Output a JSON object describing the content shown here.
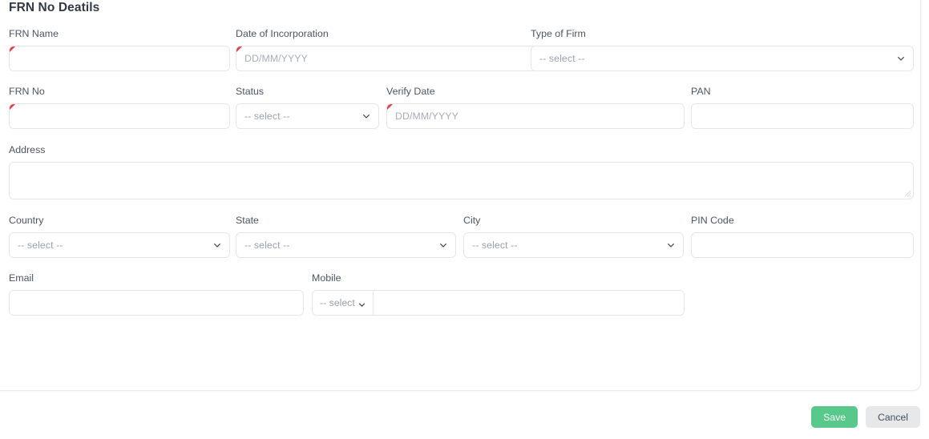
{
  "card": {
    "title": "FRN No Deatils"
  },
  "fields": {
    "frn_name": {
      "label": "FRN Name",
      "value": "",
      "required": true,
      "type": "text"
    },
    "date_of_inc": {
      "label": "Date of Incorporation",
      "value": "DD/MM/YYYY",
      "required": true,
      "type": "date"
    },
    "type_of_firm": {
      "label": "Type of Firm",
      "value": "-- select --",
      "required": false,
      "type": "select"
    },
    "frn_no": {
      "label": "FRN No",
      "value": "",
      "required": true,
      "type": "text"
    },
    "status": {
      "label": "Status",
      "value": "-- select --",
      "required": false,
      "type": "select"
    },
    "verify_date": {
      "label": "Verify Date",
      "value": "DD/MM/YYYY",
      "required": true,
      "type": "date"
    },
    "pan": {
      "label": "PAN",
      "value": "",
      "required": false,
      "type": "text"
    },
    "address": {
      "label": "Address",
      "value": "",
      "required": false,
      "type": "textarea"
    },
    "country": {
      "label": "Country",
      "value": "-- select --",
      "required": false,
      "type": "select"
    },
    "state": {
      "label": "State",
      "value": "-- select --",
      "required": false,
      "type": "select"
    },
    "city": {
      "label": "City",
      "value": "-- select --",
      "required": false,
      "type": "select"
    },
    "pin_code": {
      "label": "PIN Code",
      "value": "",
      "required": false,
      "type": "text"
    },
    "email": {
      "label": "Email",
      "value": "",
      "required": false,
      "type": "text"
    },
    "mobile": {
      "label": "Mobile",
      "value": "",
      "required": false,
      "type": "input-group",
      "prefix_value": "-- select"
    }
  },
  "footer": {
    "save_label": "Save",
    "cancel_label": "Cancel"
  },
  "colors": {
    "save_green": "#58c98b",
    "cancel_grey": "#e6e8ea",
    "required_red": "#e63946",
    "border": "#e4e7ea",
    "label_text": "#4b5563",
    "title_text": "#323a46",
    "placeholder_text": "#98a0ab"
  }
}
